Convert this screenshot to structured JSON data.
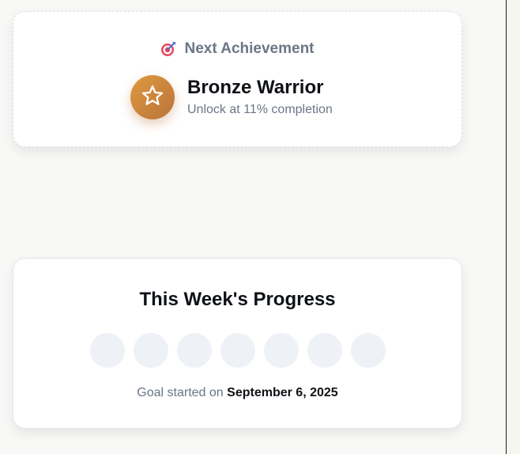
{
  "achievement": {
    "header_icon": "target-icon",
    "header": "Next Achievement",
    "badge_icon": "star-icon",
    "badge_color": "#c98440",
    "title": "Bronze Warrior",
    "subtitle": "Unlock at 11% completion"
  },
  "weekly_progress": {
    "title": "This Week's Progress",
    "days_completed": 0,
    "days_total": 7,
    "goal_prefix": "Goal started on",
    "goal_date": "September 6, 2025"
  }
}
